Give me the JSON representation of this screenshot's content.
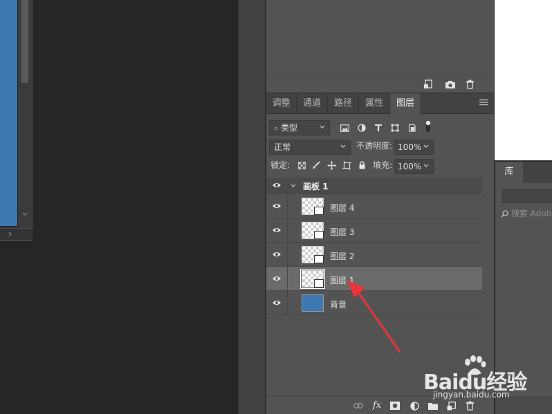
{
  "top_panel": {
    "icons": [
      "new-snapshot-icon",
      "camera-icon",
      "trash-icon"
    ]
  },
  "layers_panel": {
    "tabs": [
      {
        "label": "调整",
        "active": false
      },
      {
        "label": "通道",
        "active": false
      },
      {
        "label": "路径",
        "active": false
      },
      {
        "label": "属性",
        "active": false
      },
      {
        "label": "图层",
        "active": true
      }
    ],
    "filter": {
      "search_glyph": "⌕",
      "value": "类型"
    },
    "blend_mode": "正常",
    "opacity_label": "不透明度:",
    "opacity_value": "100%",
    "lock_label": "锁定:",
    "fill_label": "填充:",
    "fill_value": "100%",
    "group": {
      "name": "画板 1"
    },
    "layers": [
      {
        "name": "图层 4",
        "selected": false
      },
      {
        "name": "图层 3",
        "selected": false
      },
      {
        "name": "图层 2",
        "selected": false
      },
      {
        "name": "图层 1",
        "selected": true
      },
      {
        "name": "背景",
        "selected": false
      }
    ],
    "footer_icons": [
      "link-icon",
      "fx-icon",
      "mask-icon",
      "adjustment-icon",
      "folder-icon",
      "new-layer-icon",
      "trash-icon"
    ],
    "fx_label": "fx"
  },
  "library_panel": {
    "tab_label": "库",
    "search_placeholder": "搜索 Adobe"
  },
  "watermark": {
    "brand": "Baidu经验",
    "url": "jingyan.baidu.com"
  },
  "colors": {
    "panel_bg": "#535353",
    "selected_row": "#6b6b6b",
    "background_layer_blue": "#3d79b0",
    "annotation_arrow": "#e8353a"
  }
}
